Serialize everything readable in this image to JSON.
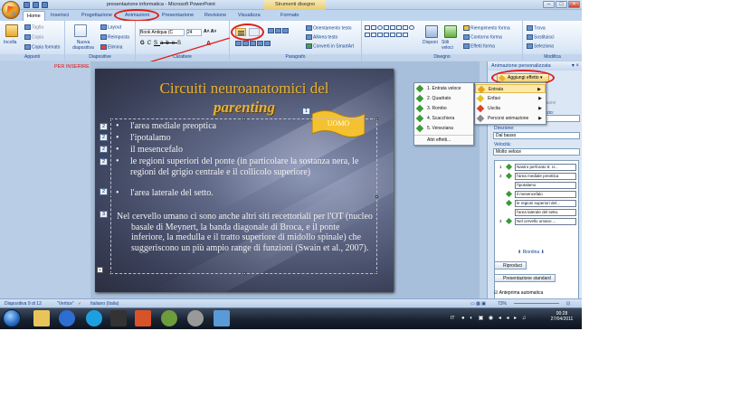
{
  "window": {
    "title": "presentazione informatica - Microsoft PowerPoint",
    "contextual_tab": "Strumenti disegno",
    "format_tab": "Formato"
  },
  "tabs": [
    "Home",
    "Inserisci",
    "Progettazione",
    "Animazioni",
    "Presentazione",
    "Revisione",
    "Visualizza"
  ],
  "ribbon": {
    "clipboard": {
      "label": "Appunti",
      "paste": "Incolla",
      "cut": "Taglia",
      "copy": "Copia",
      "format_painter": "Copia formato"
    },
    "slides": {
      "label": "Diapositive",
      "new_slide": "Nuova diapositiva",
      "layout": "Layout",
      "reset": "Reimposta",
      "delete": "Elimina"
    },
    "font": {
      "label": "Carattere",
      "font_name": "Book Antiqua (C",
      "font_size": "24"
    },
    "paragraph": {
      "label": "Paragrafo",
      "text_direction": "Orientamento testo",
      "align_text": "Allinea testo",
      "smartart": "Converti in SmartArt"
    },
    "drawing": {
      "label": "Disegno",
      "arrange": "Disponi",
      "quick_styles": "Stili veloci",
      "fill": "Riempimento forma",
      "outline": "Contorno forma",
      "effects": "Effetti forma"
    },
    "editing": {
      "label": "Modifica",
      "find": "Trova",
      "replace": "Sostituisci",
      "select": "Seleziona"
    }
  },
  "annotation": "PER INSERIRE L'ELENCO PUNTATO",
  "slide": {
    "title_line1": "Circuiti neuroanatomici del",
    "title_line2": "parenting",
    "shape_label": "UOMO",
    "shape_tag": "1",
    "bullets": [
      {
        "tag": "2",
        "text": "l'area mediale preoptica"
      },
      {
        "tag": "2",
        "text": "l'ipotalamo"
      },
      {
        "tag": "2",
        "text": "il mesencefalo"
      },
      {
        "tag": "2",
        "text": "le regioni superiori del ponte (in particolare la sostanza nera, le regioni del grigio centrale e il collicolo superiore)"
      },
      {
        "tag": "2",
        "text": "l'area laterale del setto."
      }
    ],
    "paragraph_tag": "3",
    "paragraph": "Nel cervello umano ci sono anche altri siti recettoriali per l'OT (nucleo basale di Meynert, la banda diagonale di Broca, e il ponte inferiore, la medulla e il tratto superiore di midollo spinale) che suggeriscono un più ampio range di funzioni (Swain et al., 2007)."
  },
  "entrance_menu": [
    "1. Entrata veloce",
    "2. Quadrato",
    "3. Rombo",
    "4. Scacchiera",
    "5. Veneziana",
    "Altri effetti..."
  ],
  "effect_menu": [
    "Entrata",
    "Enfasi",
    "Uscita",
    "Percorsi animazione"
  ],
  "anim_panel": {
    "title": "Animazione personalizzata",
    "add_effect": "Aggiungi effetto",
    "remove": "Rimuovi",
    "start_label": "Inizio:",
    "direction_label": "Direzione:",
    "direction_value": "Dal basso",
    "speed_label": "Velocità:",
    "speed_value": "Molto veloce",
    "list": [
      {
        "num": "1",
        "text": "Nastro perforato 6: U..."
      },
      {
        "num": "2",
        "text": "l'area mediale preottica"
      },
      {
        "num": "",
        "text": "l'ipotalamo"
      },
      {
        "num": "",
        "text": "il mesencefalo"
      },
      {
        "num": "",
        "text": "le regioni superiori del..."
      },
      {
        "num": "",
        "text": "l'area laterale del setto."
      },
      {
        "num": "3",
        "text": "Nel cervello umano ..."
      }
    ],
    "reorder": "Riordina",
    "play": "Riproduci",
    "slideshow": "Presentazione standard",
    "autopreview": "Anteprima automatica"
  },
  "status": {
    "slide": "Diapositiva 9 di 12",
    "theme": "\"Vertice\"",
    "language": "Italiano (Italia)",
    "zoom": "73%"
  },
  "taskbar": {
    "lang": "IT",
    "time": "00:28",
    "date": "27/04/2011"
  }
}
